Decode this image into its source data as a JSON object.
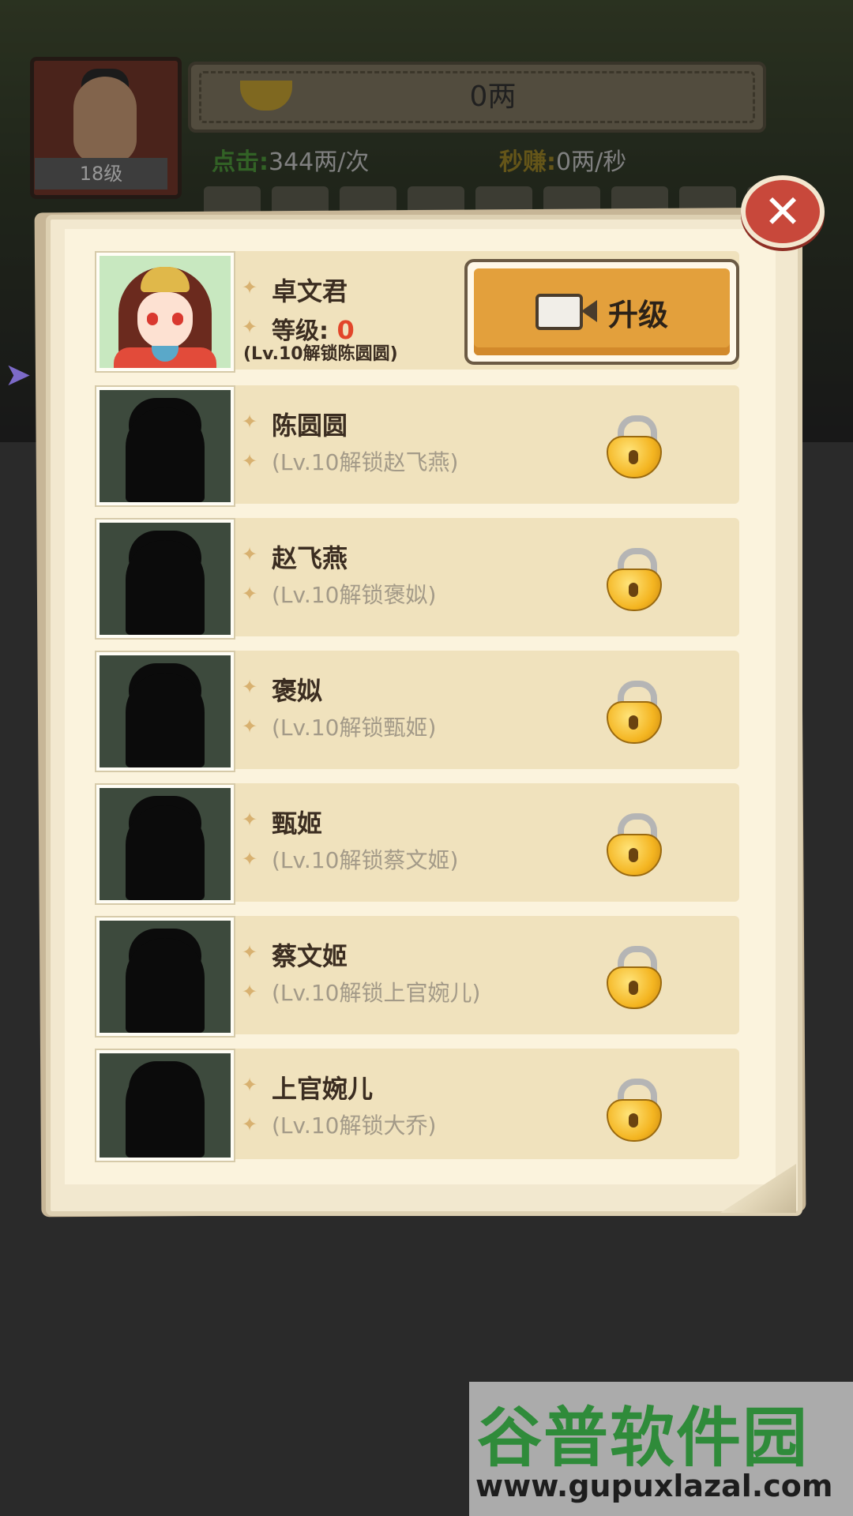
{
  "hud": {
    "player_level": "18级",
    "money": "0两",
    "click_label": "点击:",
    "click_value": "344两/次",
    "sec_label": "秒赚:",
    "sec_value": "0两/秒"
  },
  "panel": {
    "current": {
      "name": "卓文君",
      "level_label": "等级:",
      "level_value": "0",
      "unlock_hint": "(Lv.10解锁陈圆圆)",
      "upgrade_label": "升级"
    },
    "locked_list": [
      {
        "name": "陈圆圆",
        "hint": "(Lv.10解锁赵飞燕)"
      },
      {
        "name": "赵飞燕",
        "hint": "(Lv.10解锁褒姒)"
      },
      {
        "name": "褒姒",
        "hint": "(Lv.10解锁甄姬)"
      },
      {
        "name": "甄姬",
        "hint": "(Lv.10解锁蔡文姬)"
      },
      {
        "name": "蔡文姬",
        "hint": "(Lv.10解锁上官婉儿)"
      },
      {
        "name": "上官婉儿",
        "hint": "(Lv.10解锁大乔)"
      }
    ]
  },
  "watermark": {
    "logo": "谷普软件园",
    "url": "www.gupuxlazal.com"
  },
  "colors": {
    "accent_orange": "#e3a03c",
    "close_red": "#c8483b",
    "level_red": "#e2462a"
  }
}
